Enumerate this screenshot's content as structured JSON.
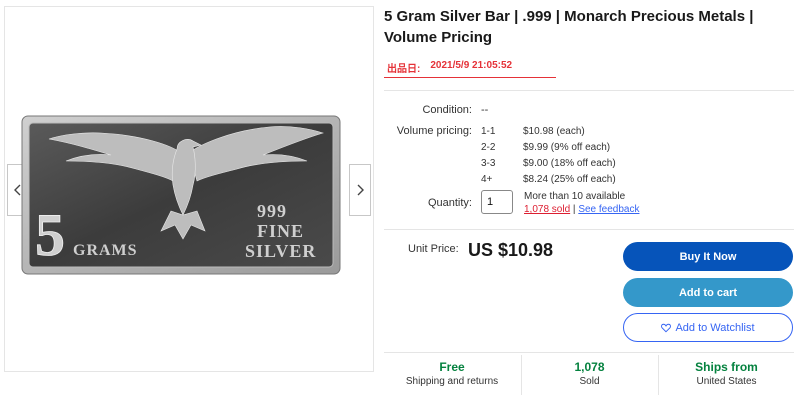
{
  "gallery": {
    "prev_icon": "chevron-left-icon",
    "next_icon": "chevron-right-icon",
    "bar": {
      "big_number": "5",
      "unit": "GRAMS",
      "purity": "999",
      "fine": "FINE",
      "metal": "SILVER"
    }
  },
  "product": {
    "title": "5 Gram Silver Bar | .999 | Monarch Precious Metals | Volume Pricing",
    "listed_label": "出品日:",
    "listed_date": "2021/5/9 21:05:52",
    "condition_label": "Condition:",
    "condition_value": "--",
    "volume_label": "Volume pricing:",
    "volume_pricing": [
      {
        "qty": "1-1",
        "price": "$10.98  (each)"
      },
      {
        "qty": "2-2",
        "price": "$9.99  (9% off each)"
      },
      {
        "qty": "3-3",
        "price": "$9.00  (18% off each)"
      },
      {
        "qty": "4+",
        "price": "$8.24  (25% off each)"
      }
    ],
    "quantity_label": "Quantity:",
    "quantity_value": "1",
    "availability": "More than 10 available",
    "sold_count_text": "1,078 sold",
    "sold_separator": " | ",
    "feedback_text": "See feedback",
    "unit_price_label": "Unit Price:",
    "unit_price": "US $10.98"
  },
  "actions": {
    "buy_now": "Buy It Now",
    "add_to_cart": "Add to cart",
    "watchlist": "Add to Watchlist",
    "watch_icon": "heart-icon"
  },
  "features": [
    {
      "title": "Free",
      "subtitle": "Shipping and returns"
    },
    {
      "title": "1,078",
      "subtitle": "Sold"
    },
    {
      "title": "Ships from",
      "subtitle": "United States"
    }
  ],
  "colors": {
    "buy_now_bg": "#0654ba",
    "cart_bg": "#3498ca",
    "link_blue": "#3665f3",
    "red": "#e53238",
    "green": "#05823f"
  }
}
